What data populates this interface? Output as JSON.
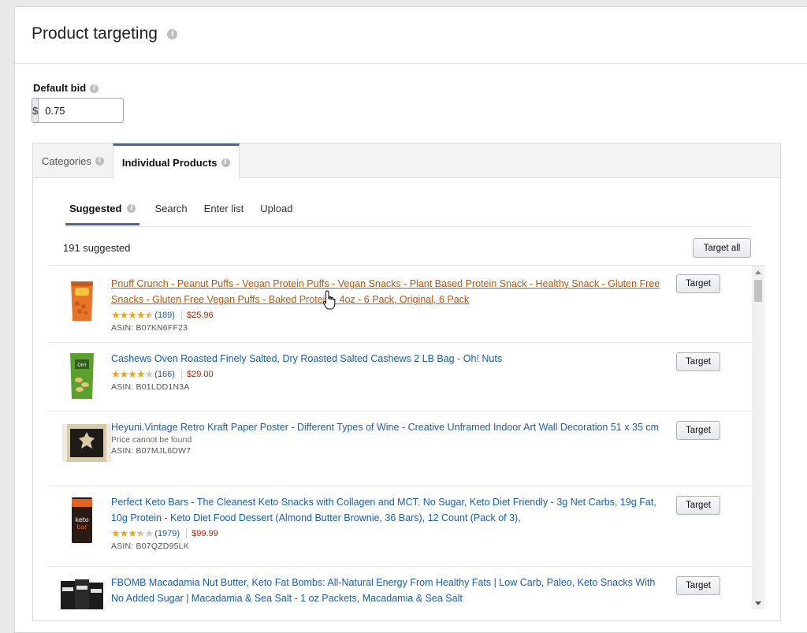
{
  "header": {
    "title": "Product targeting"
  },
  "bid": {
    "label": "Default bid",
    "currency": "$",
    "value": "0.75"
  },
  "tabs": [
    {
      "label": "Categories"
    },
    {
      "label": "Individual Products"
    }
  ],
  "subtabs": [
    {
      "label": "Suggested"
    },
    {
      "label": "Search"
    },
    {
      "label": "Enter list"
    },
    {
      "label": "Upload"
    }
  ],
  "suggested_count": "191 suggested",
  "target_all_label": "Target all",
  "target_label": "Target",
  "products": [
    {
      "title": "Pnuff Crunch - Peanut Puffs - Vegan Protein Puffs - Vegan Snacks - Plant Based Protein Snack - Healthy Snack - Gluten Free Snacks - Gluten Free Vegan Puffs - Baked Protein - 4oz - 6 Pack, Original, 6 Pack",
      "rating": 4.5,
      "reviews": "(189)",
      "price": "$25.96",
      "asin": "ASIN: B07KN6FF23"
    },
    {
      "title": "Cashews Oven Roasted Finely Salted, Dry Roasted Salted Cashews 2 LB Bag - Oh! Nuts",
      "rating": 4,
      "reviews": "(166)",
      "price": "$29.00",
      "asin": "ASIN: B01LDD1N3A"
    },
    {
      "title": "Heyuni.Vintage Retro Kraft Paper Poster - Different Types of Wine - Creative Unframed Indoor Art Wall Decoration 51 x 35 cm",
      "price_note": "Price cannot be found",
      "asin": "ASIN: B07MJL6DW7"
    },
    {
      "title": "Perfect Keto Bars - The Cleanest Keto Snacks with Collagen and MCT. No Sugar, Keto Diet Friendly - 3g Net Carbs, 19g Fat, 10g Protein - Keto Diet Food Dessert (Almond Butter Brownie, 36 Bars), 12 Count (Pack of 3),",
      "rating": 3.5,
      "reviews": "(1979)",
      "price": "$99.99",
      "asin": "ASIN: B07QZD95LK"
    },
    {
      "title": "FBOMB Macadamia Nut Butter, Keto Fat Bombs: All-Natural Energy From Healthy Fats | Low Carb, Paleo, Keto Snacks With No Added Sugar | Macadamia & Sea Salt - 1 oz Packets, Macadamia & Sea Salt"
    }
  ],
  "colors": {
    "link": "#1a5ea6",
    "link_hover": "#c45500",
    "price": "#b12704",
    "star": "#f0a31c",
    "tab_accent": "#4f6789"
  }
}
